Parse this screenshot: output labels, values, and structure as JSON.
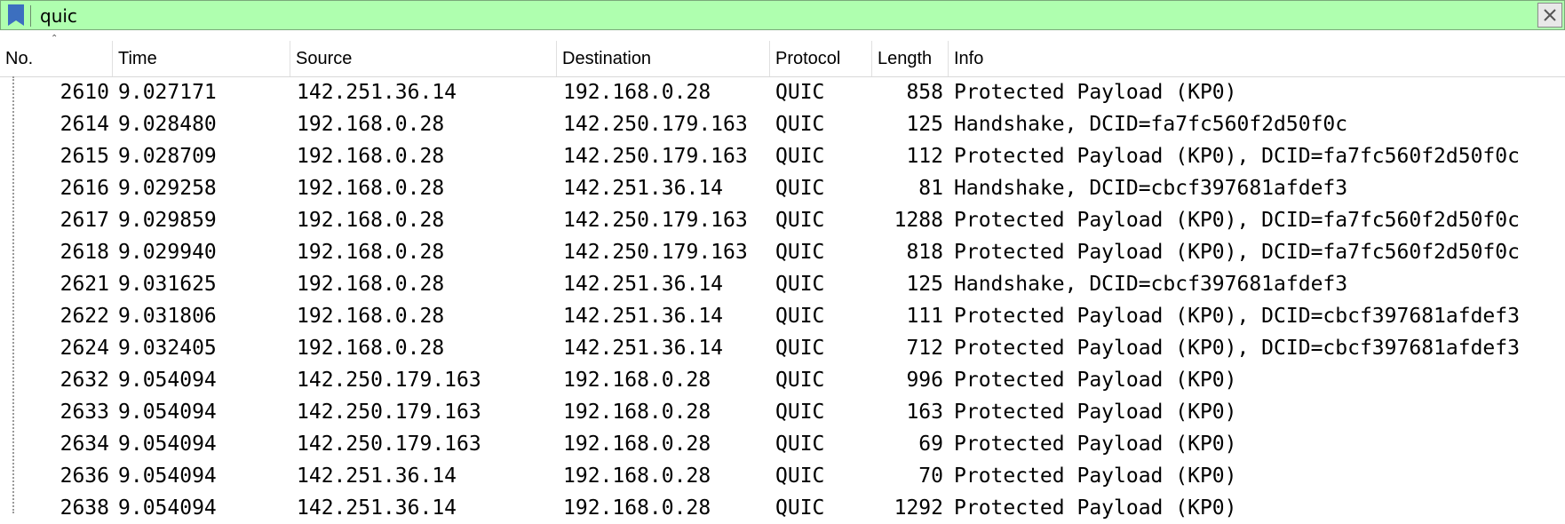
{
  "filter": {
    "value": "quic",
    "bookmark_icon": "bookmark-icon",
    "clear_icon": "close-icon",
    "bg_color": "#afffaf"
  },
  "columns": {
    "no": "No.",
    "time": "Time",
    "source": "Source",
    "destination": "Destination",
    "protocol": "Protocol",
    "length": "Length",
    "info": "Info"
  },
  "packets": [
    {
      "no": "2610",
      "time": "9.027171",
      "source": "142.251.36.14",
      "destination": "192.168.0.28",
      "protocol": "QUIC",
      "length": "858",
      "info": "Protected Payload (KP0)"
    },
    {
      "no": "2614",
      "time": "9.028480",
      "source": "192.168.0.28",
      "destination": "142.250.179.163",
      "protocol": "QUIC",
      "length": "125",
      "info": "Handshake, DCID=fa7fc560f2d50f0c"
    },
    {
      "no": "2615",
      "time": "9.028709",
      "source": "192.168.0.28",
      "destination": "142.250.179.163",
      "protocol": "QUIC",
      "length": "112",
      "info": "Protected Payload (KP0), DCID=fa7fc560f2d50f0c"
    },
    {
      "no": "2616",
      "time": "9.029258",
      "source": "192.168.0.28",
      "destination": "142.251.36.14",
      "protocol": "QUIC",
      "length": "81",
      "info": "Handshake, DCID=cbcf397681afdef3"
    },
    {
      "no": "2617",
      "time": "9.029859",
      "source": "192.168.0.28",
      "destination": "142.250.179.163",
      "protocol": "QUIC",
      "length": "1288",
      "info": "Protected Payload (KP0), DCID=fa7fc560f2d50f0c"
    },
    {
      "no": "2618",
      "time": "9.029940",
      "source": "192.168.0.28",
      "destination": "142.250.179.163",
      "protocol": "QUIC",
      "length": "818",
      "info": "Protected Payload (KP0), DCID=fa7fc560f2d50f0c"
    },
    {
      "no": "2621",
      "time": "9.031625",
      "source": "192.168.0.28",
      "destination": "142.251.36.14",
      "protocol": "QUIC",
      "length": "125",
      "info": "Handshake, DCID=cbcf397681afdef3"
    },
    {
      "no": "2622",
      "time": "9.031806",
      "source": "192.168.0.28",
      "destination": "142.251.36.14",
      "protocol": "QUIC",
      "length": "111",
      "info": "Protected Payload (KP0), DCID=cbcf397681afdef3"
    },
    {
      "no": "2624",
      "time": "9.032405",
      "source": "192.168.0.28",
      "destination": "142.251.36.14",
      "protocol": "QUIC",
      "length": "712",
      "info": "Protected Payload (KP0), DCID=cbcf397681afdef3"
    },
    {
      "no": "2632",
      "time": "9.054094",
      "source": "142.250.179.163",
      "destination": "192.168.0.28",
      "protocol": "QUIC",
      "length": "996",
      "info": "Protected Payload (KP0)"
    },
    {
      "no": "2633",
      "time": "9.054094",
      "source": "142.250.179.163",
      "destination": "192.168.0.28",
      "protocol": "QUIC",
      "length": "163",
      "info": "Protected Payload (KP0)"
    },
    {
      "no": "2634",
      "time": "9.054094",
      "source": "142.250.179.163",
      "destination": "192.168.0.28",
      "protocol": "QUIC",
      "length": "69",
      "info": "Protected Payload (KP0)"
    },
    {
      "no": "2636",
      "time": "9.054094",
      "source": "142.251.36.14",
      "destination": "192.168.0.28",
      "protocol": "QUIC",
      "length": "70",
      "info": "Protected Payload (KP0)"
    },
    {
      "no": "2638",
      "time": "9.054094",
      "source": "142.251.36.14",
      "destination": "192.168.0.28",
      "protocol": "QUIC",
      "length": "1292",
      "info": "Protected Payload (KP0)"
    }
  ]
}
